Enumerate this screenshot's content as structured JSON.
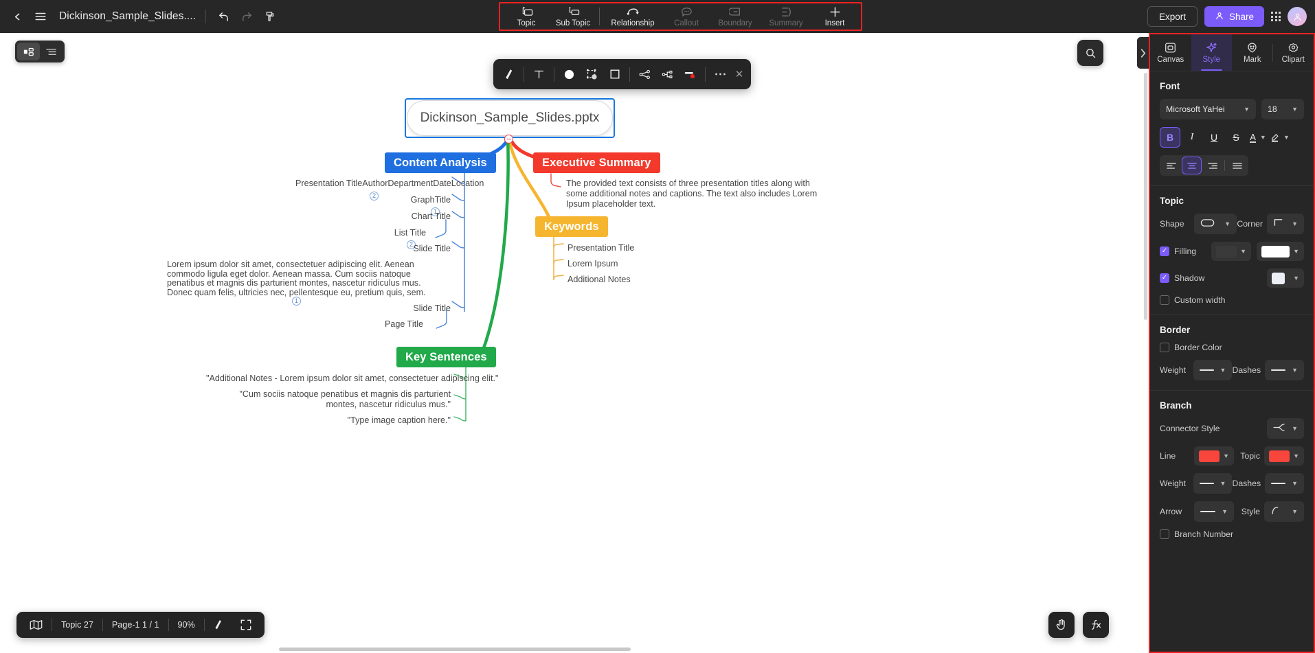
{
  "topbar": {
    "back_icon": "chevron-left-icon",
    "menu_icon": "hamburger-menu-icon",
    "doc_title": "Dickinson_Sample_Slides....",
    "undo_icon": "undo-icon",
    "redo_icon": "redo-icon",
    "theme_icon": "paint-format-icon",
    "tools": [
      {
        "label": "Topic",
        "icon": "topic-icon",
        "disabled": false
      },
      {
        "label": "Sub Topic",
        "icon": "subtopic-icon",
        "disabled": false
      },
      {
        "label": "Relationship",
        "icon": "relationship-arc-icon",
        "disabled": false
      },
      {
        "label": "Callout",
        "icon": "callout-bubble-icon",
        "disabled": true
      },
      {
        "label": "Boundary",
        "icon": "boundary-icon",
        "disabled": true
      },
      {
        "label": "Summary",
        "icon": "summary-brace-icon",
        "disabled": true
      },
      {
        "label": "Insert",
        "icon": "plus-icon",
        "disabled": false
      }
    ],
    "export_label": "Export",
    "share_label": "Share",
    "share_icon": "person-icon",
    "apps_icon": "grid-apps-icon",
    "avatar_icon": "user-avatar"
  },
  "canvas": {
    "view_toggle": [
      {
        "icon": "mindmap-view-icon",
        "active": true
      },
      {
        "icon": "outline-view-icon",
        "active": false
      }
    ],
    "search_icon": "search-icon",
    "panel_collapse_icon": "chevron-right-icon",
    "format_toolbar": {
      "items": [
        {
          "icon": "brush-format-painter-icon"
        },
        {
          "icon": "text-style-icon"
        },
        {
          "icon": "fill-circle-icon"
        },
        {
          "icon": "shape-fill-icon"
        },
        {
          "icon": "shape-outline-icon"
        },
        {
          "icon": "branch-layout-icon"
        },
        {
          "icon": "connector-style-icon"
        },
        {
          "icon": "line-color-icon"
        },
        {
          "icon": "more-options-icon"
        }
      ],
      "close_icon": "close-icon"
    },
    "root": {
      "label": "Dickinson_Sample_Slides.pptx",
      "collapse_handle": "collapse-handle"
    },
    "topics": [
      {
        "label": "Content Analysis",
        "color": "#1f6fe0"
      },
      {
        "label": "Executive Summary",
        "color": "#f2392c"
      },
      {
        "label": "Keywords",
        "color": "#f5b52e"
      },
      {
        "label": "Key Sentences",
        "color": "#21a94a"
      }
    ],
    "content_analysis_leaves": [
      "Presentation TitleAuthorDepartmentDateLocation",
      "GraphTitle",
      "Chart Title",
      "List Title",
      "Slide Title",
      "Lorem ipsum dolor sit amet, consectetuer adipiscing elit. Aenean commodo ligula eget dolor. Aenean massa. Cum sociis natoque penatibus et magnis dis parturient montes, nascetur ridiculus mus. Donec quam felis, ultricies nec, pellentesque eu, pretium quis, sem.",
      "Slide Title",
      "Page Title"
    ],
    "content_analysis_badges": [
      "2",
      "1",
      "2",
      "1"
    ],
    "executive_summary_text": "The provided text consists of three presentation titles along with some additional notes and captions. The text also includes Lorem Ipsum placeholder text.",
    "keywords_leaves": [
      "Presentation Title",
      "Lorem Ipsum",
      "Additional Notes"
    ],
    "key_sentences_leaves": [
      "\"Additional Notes - Lorem ipsum dolor sit amet, consectetuer adipiscing elit.\"",
      "\"Cum sociis natoque penatibus et magnis dis parturient montes, nascetur ridiculus mus.\"",
      "\"Type image caption here.\""
    ]
  },
  "statusbar": {
    "map_icon": "map-overview-icon",
    "topic_count": "Topic 27",
    "page_info": "Page-1  1 / 1",
    "zoom": "90%",
    "brush_icon": "brush-icon",
    "fullscreen_icon": "fullscreen-icon",
    "hand_icon": "hand-pan-icon",
    "formula_icon": "fn-formula-icon"
  },
  "rpanel": {
    "tabs": [
      {
        "label": "Canvas",
        "icon": "canvas-icon",
        "active": false
      },
      {
        "label": "Style",
        "icon": "style-sparkle-icon",
        "active": true
      },
      {
        "label": "Mark",
        "icon": "mark-smiley-icon",
        "active": false
      },
      {
        "label": "Clipart",
        "icon": "clipart-icon",
        "active": false
      }
    ],
    "font": {
      "title": "Font",
      "family": "Microsoft YaHei",
      "size": "18",
      "bold_active": true,
      "buttons": [
        "B",
        "I",
        "U",
        "S",
        "A",
        "highlight"
      ],
      "align_active_index": 1,
      "align_icons": [
        "align-left-icon",
        "align-center-icon",
        "align-right-icon",
        "align-justify-icon"
      ]
    },
    "topic": {
      "title": "Topic",
      "shape_label": "Shape",
      "shape_icon": "rounded-rect-shape-icon",
      "corner_label": "Corner",
      "corner_icon": "sharp-corner-icon",
      "filling_label": "Filling",
      "filling_checked": true,
      "filling_swatch1": "#3a3a3a",
      "filling_swatch2": "#ffffff",
      "shadow_label": "Shadow",
      "shadow_checked": true,
      "shadow_swatch": "#eceff5",
      "custom_width_label": "Custom width",
      "custom_width_checked": false
    },
    "border": {
      "title": "Border",
      "color_label": "Border Color",
      "color_checked": false,
      "weight_label": "Weight",
      "dashes_label": "Dashes"
    },
    "branch": {
      "title": "Branch",
      "connector_label": "Connector Style",
      "connector_icon": "connector-fork-icon",
      "line_label": "Line",
      "line_color": "#f9463c",
      "topic_label": "Topic",
      "topic_color": "#f9463c",
      "weight_label": "Weight",
      "dashes_label": "Dashes",
      "arrow_label": "Arrow",
      "style_label": "Style",
      "style_icon": "curve-style-icon",
      "branch_number_label": "Branch Number",
      "branch_number_checked": false
    }
  }
}
